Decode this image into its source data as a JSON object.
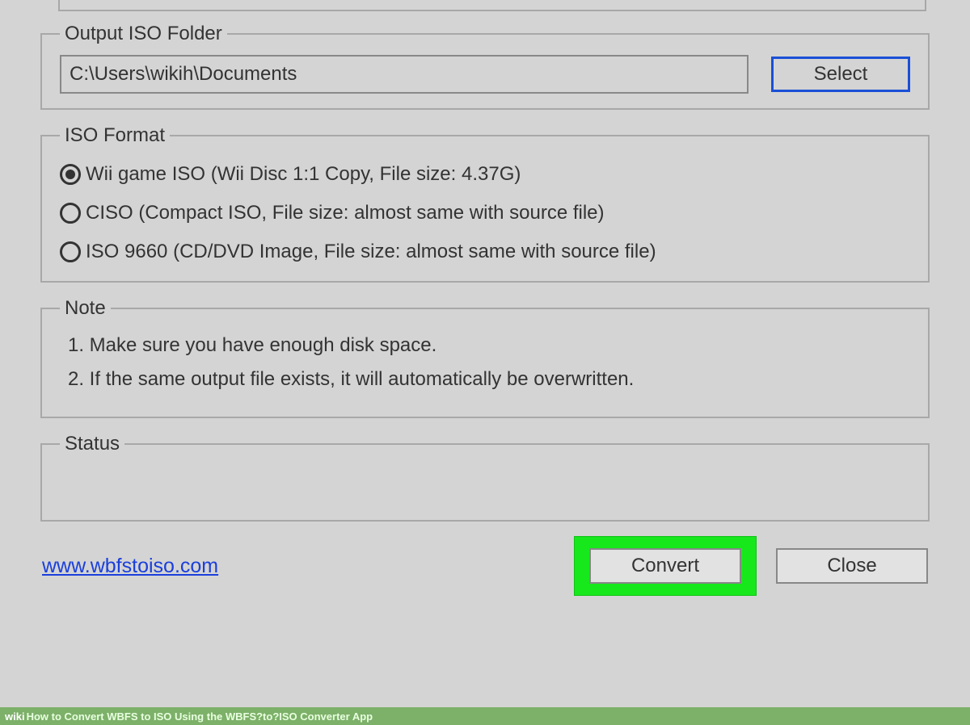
{
  "output_folder": {
    "legend": "Output ISO Folder",
    "path": "C:\\Users\\wikih\\Documents",
    "select_label": "Select"
  },
  "iso_format": {
    "legend": "ISO Format",
    "options": [
      {
        "label": "Wii game ISO (Wii Disc 1:1 Copy, File size: 4.37G)",
        "selected": true
      },
      {
        "label": "CISO (Compact ISO, File size: almost same with source file)",
        "selected": false
      },
      {
        "label": "ISO 9660 (CD/DVD Image, File size: almost same with source file)",
        "selected": false
      }
    ]
  },
  "note": {
    "legend": "Note",
    "items": [
      "1. Make sure you have enough disk space.",
      "2. If the same output file exists, it will automatically be overwritten."
    ]
  },
  "status": {
    "legend": "Status"
  },
  "footer": {
    "url": "www.wbfstoiso.com",
    "convert_label": "Convert",
    "close_label": "Close"
  },
  "caption": {
    "prefix": "wiki",
    "text": "How to Convert WBFS to ISO Using the WBFS?to?ISO Converter App"
  }
}
